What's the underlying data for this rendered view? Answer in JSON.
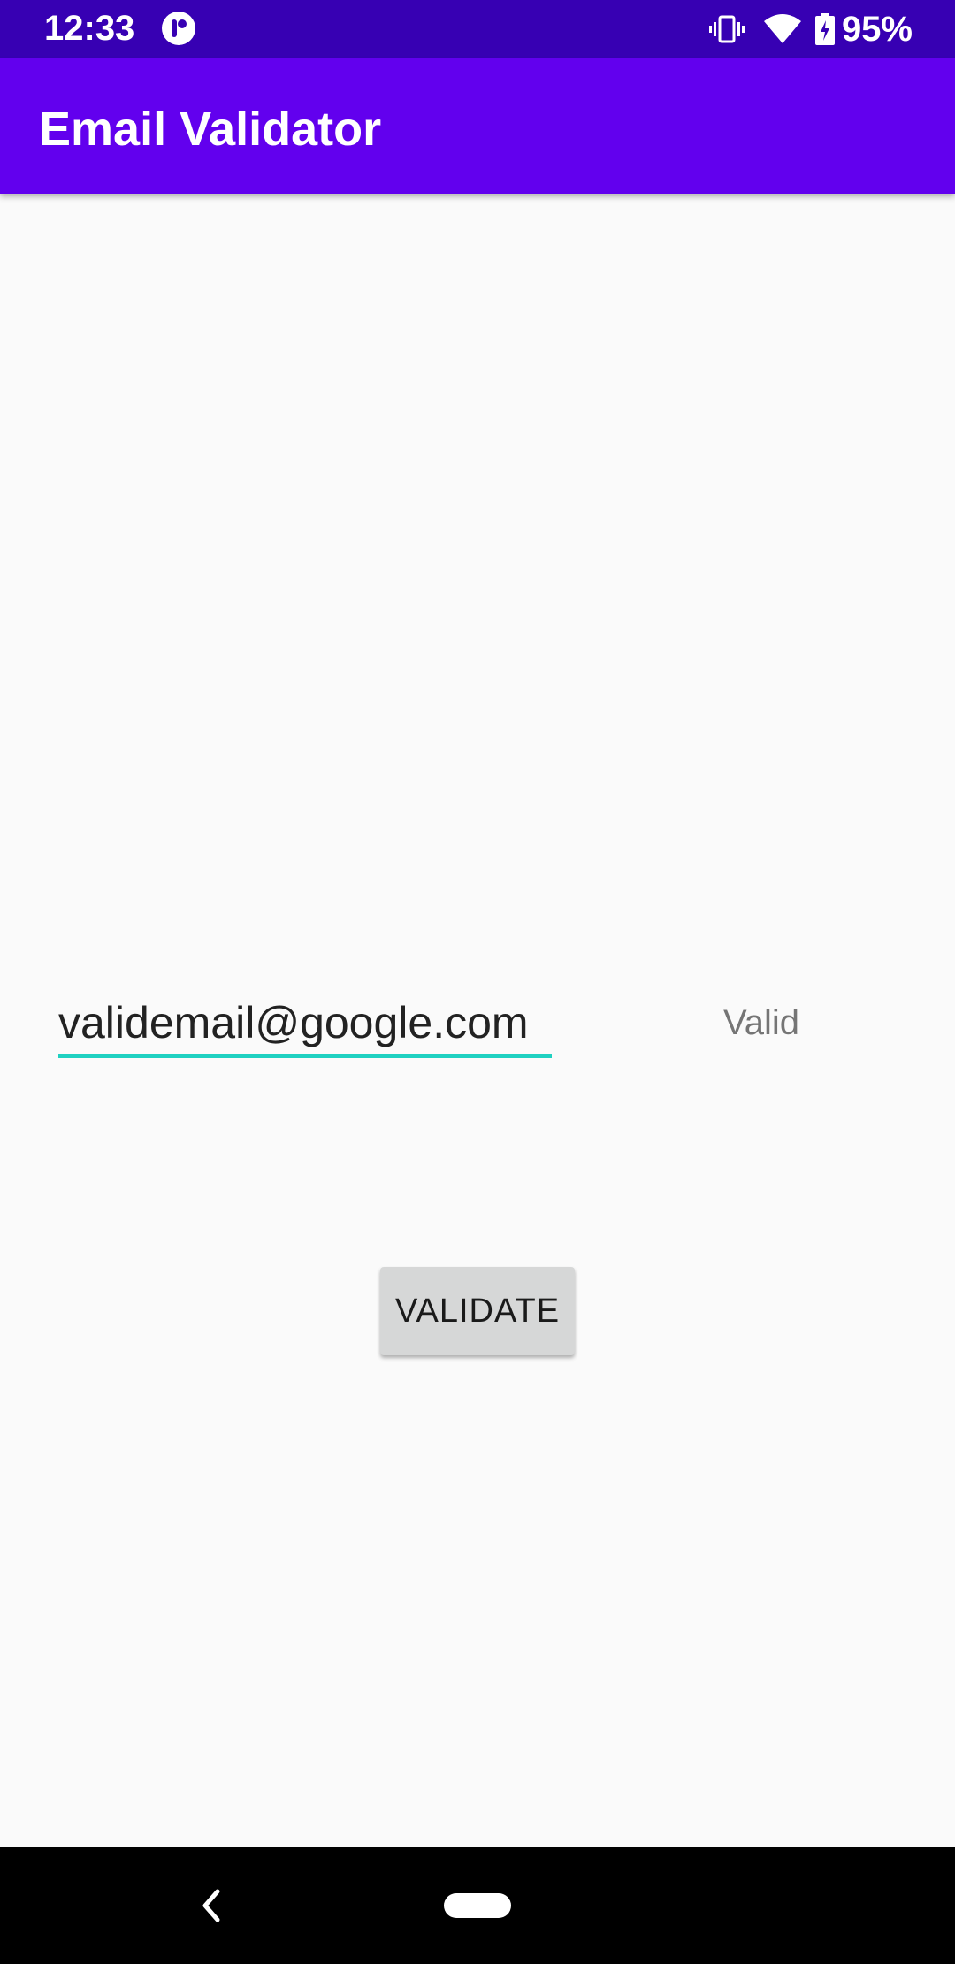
{
  "status_bar": {
    "time": "12:33",
    "battery_percent": "95%",
    "icons": [
      "app-notification-icon",
      "vibrate-icon",
      "wifi-icon",
      "battery-charging-icon"
    ]
  },
  "app_bar": {
    "title": "Email Validator"
  },
  "form": {
    "email_value": "validemail@google.com",
    "status_text": "Valid",
    "validate_label": "VALIDATE"
  },
  "nav_bar": {
    "icons": [
      "back-icon",
      "home-pill-icon"
    ]
  },
  "colors": {
    "status_bar": "#3700B3",
    "app_bar": "#6200EE",
    "input_underline": "#1FD1C1",
    "background": "#FAFAFA",
    "button": "#D6D7D7"
  }
}
